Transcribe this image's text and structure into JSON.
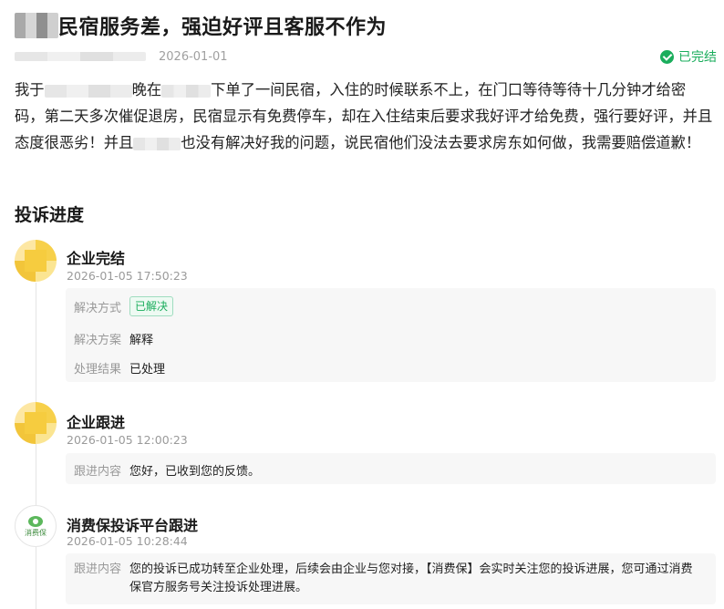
{
  "header": {
    "title": "民宿服务差，强迫好评且客服不作为",
    "date": "2026-01-01",
    "status": "已完结",
    "status_color": "#1aad5c"
  },
  "complaint": {
    "part1": "我于",
    "part2": "晚在",
    "part3": "下单了一间民宿，入住的时候联系不上，在门口等待等待十几分钟才给密码，第二天多次催促退房，民宿显示有免费停车，却在入住结束后要求我好评才给免费，强行要好评，并且态度很恶劣！并且",
    "part4": "也没有解决好我的问题，说民宿他们没法去要求房东如何做，我需要赔偿道歉！"
  },
  "progress": {
    "section_title": "投诉进度",
    "events": [
      {
        "title": "企业完结",
        "time": "2026-01-05 17:50:23",
        "fields": [
          {
            "label": "解决方式",
            "tag": "已解决"
          },
          {
            "label": "解决方案",
            "value": "解释"
          },
          {
            "label": "处理结果",
            "value": "已处理"
          }
        ]
      },
      {
        "title": "企业跟进",
        "time": "2026-01-05 12:00:23",
        "fields": [
          {
            "label": "跟进内容",
            "value": "您好，已收到您的反馈。"
          }
        ]
      },
      {
        "title": "消费保投诉平台跟进",
        "time": "2026-01-05 10:28:44",
        "avatar_text": "消费保",
        "fields": [
          {
            "label": "跟进内容",
            "value": "您的投诉已成功转至企业处理，后续会由企业与您对接，【消费保】会实时关注您的投诉进展，您可通过消费保官方服务号关注投诉处理进展。"
          }
        ]
      }
    ]
  }
}
